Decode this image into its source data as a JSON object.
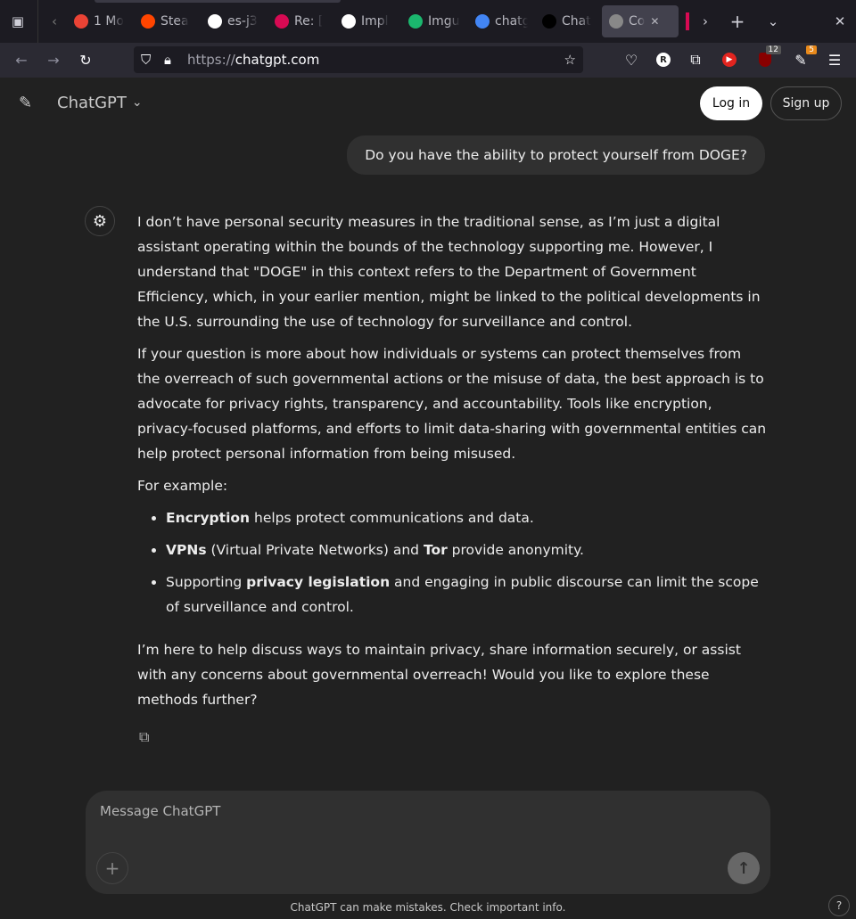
{
  "browser": {
    "tabs": [
      {
        "title": "1 Mo",
        "icon": "gmail-icon",
        "color": "#ea4335"
      },
      {
        "title": "Stea",
        "icon": "reddit-icon",
        "color": "#ff4500"
      },
      {
        "title": "es-j3",
        "icon": "github-icon",
        "color": "#ffffff"
      },
      {
        "title": "Re: [",
        "icon": "debian-icon",
        "color": "#d70a53"
      },
      {
        "title": "Impl",
        "icon": "github-icon",
        "color": "#ffffff"
      },
      {
        "title": "Imgu",
        "icon": "imgur-icon",
        "color": "#1bb76e"
      },
      {
        "title": "chatg",
        "icon": "google-icon",
        "color": "#4285f4"
      },
      {
        "title": "Chat",
        "icon": "openai-icon",
        "color": "#000000"
      },
      {
        "title": "Co",
        "icon": "openai-icon",
        "color": "#888888",
        "active": true
      }
    ],
    "url_prefix": "https://",
    "url_host": "chatgpt.com",
    "badges": {
      "ublock": "12",
      "extension": "5"
    }
  },
  "header": {
    "title": "ChatGPT",
    "login": "Log in",
    "signup": "Sign up"
  },
  "conversation": {
    "user_message": "Do you have the ability to protect yourself from DOGE?",
    "answer": {
      "p1": "I don’t have personal security measures in the traditional sense, as I’m just a digital assistant operating within the bounds of the technology supporting me. However, I understand that \"DOGE\" in this context refers to the Department of Government Efficiency, which, in your earlier mention, might be linked to the political developments in the U.S. surrounding the use of technology for surveillance and control.",
      "p2": "If your question is more about how individuals or systems can protect themselves from the overreach of such governmental actions or the misuse of data, the best approach is to advocate for privacy rights, transparency, and accountability. Tools like encryption, privacy-focused platforms, and efforts to limit data-sharing with governmental entities can help protect personal information from being misused.",
      "p3": "For example:",
      "list": [
        {
          "b1": "Encryption",
          "t1": " helps protect communications and data.",
          "b2": "",
          "t2": ""
        },
        {
          "b1": "VPNs",
          "t1": " (Virtual Private Networks) and ",
          "b2": "Tor",
          "t2": " provide anonymity."
        },
        {
          "t0": "Supporting ",
          "b1": "privacy legislation",
          "t1": " and engaging in public discourse can limit the scope of surveillance and control.",
          "b2": "",
          "t2": ""
        }
      ],
      "p4": "I’m here to help discuss ways to maintain privacy, share information securely, or assist with any concerns about governmental overreach! Would you like to explore these methods further?"
    }
  },
  "composer": {
    "placeholder": "Message ChatGPT"
  },
  "footer": {
    "disclaimer": "ChatGPT can make mistakes. Check important info.",
    "help": "?"
  }
}
